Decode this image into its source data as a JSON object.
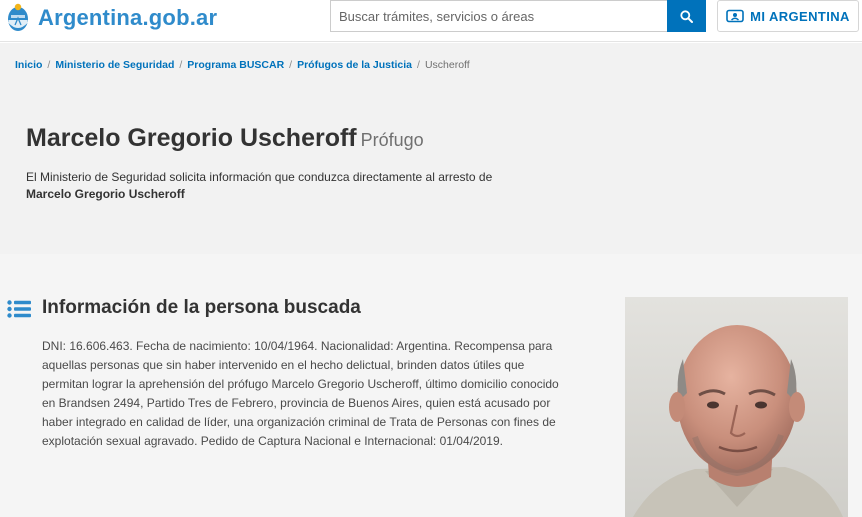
{
  "header": {
    "logo_text": "Argentina.gob.ar",
    "search_placeholder": "Buscar trámites, servicios o áreas",
    "mi_argentina_label": "MI ARGENTINA"
  },
  "breadcrumb": [
    "Inicio",
    "Ministerio de Seguridad",
    "Programa BUSCAR",
    "Prófugos de la Justicia",
    "Uscheroff"
  ],
  "hero": {
    "title": "Marcelo Gregorio Uscheroff",
    "status": "Prófugo",
    "lead": "El Ministerio de Seguridad solicita información que conduzca directamente al arresto de",
    "lead_name": "Marcelo Gregorio Uscheroff"
  },
  "section": {
    "title": "Información de la persona buscada",
    "body": "DNI: 16.606.463. Fecha de nacimiento: 10/04/1964. Nacionalidad: Argentina. Recompensa para aquellas personas que sin haber intervenido en el hecho delictual, brinden datos útiles que permitan lograr la aprehensión del prófugo Marcelo Gregorio Uscheroff, último domicilio conocido en Brandsen 2494, Partido Tres de Febrero, provincia de Buenos Aires, quien está acusado por haber integrado en calidad de líder, una organización criminal de Trata de Personas con fines de explotación sexual agravado. Pedido de Captura Nacional e Internacional: 01/04/2019."
  },
  "colors": {
    "brand_blue": "#2f8bcb",
    "primary": "#0072bb",
    "hero_bg": "#f2f2f2",
    "content_bg": "#f5f5f5"
  },
  "icons": {
    "logo": "argentina-shield-icon",
    "search": "search-icon",
    "mi_argentina": "id-card-icon",
    "section": "list-icon"
  }
}
